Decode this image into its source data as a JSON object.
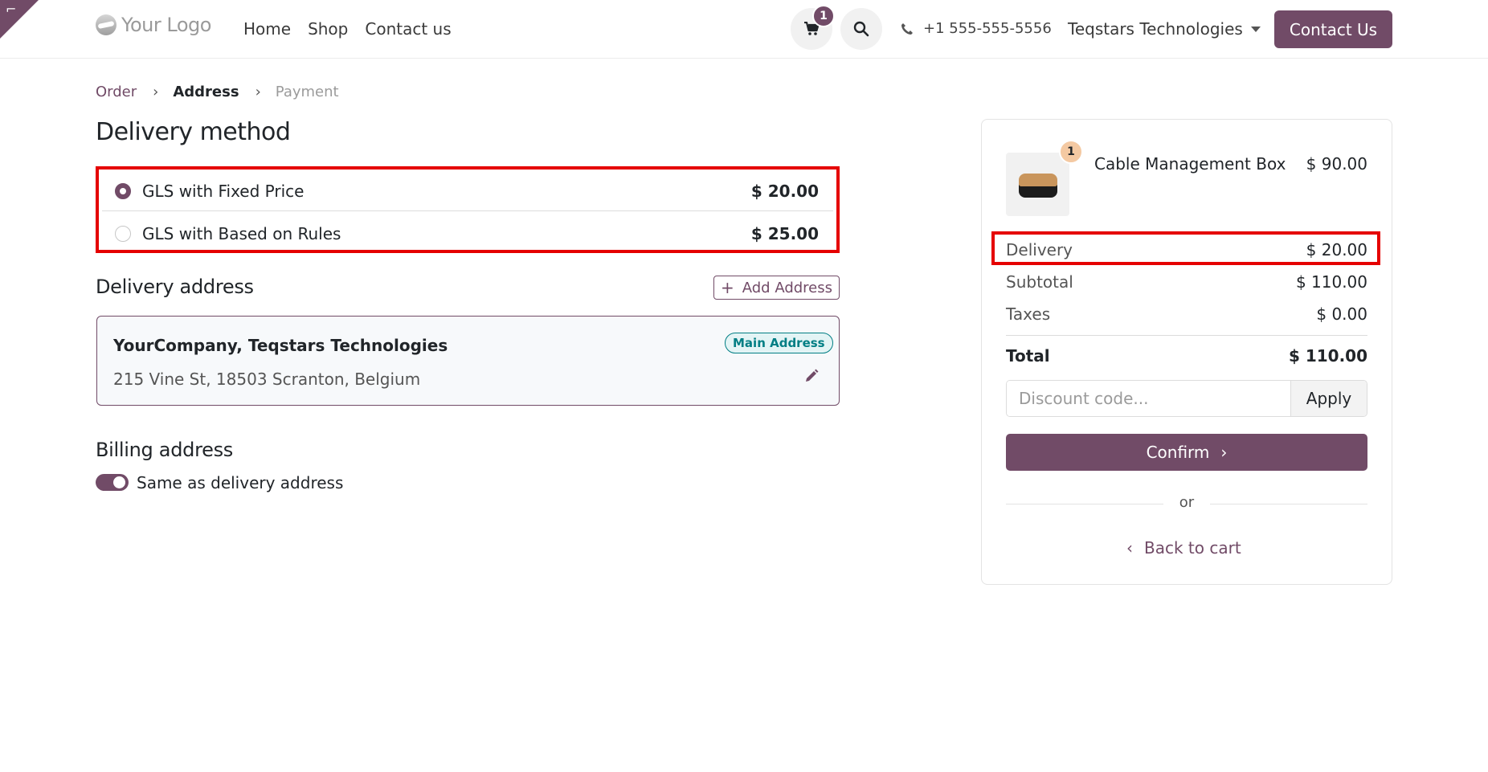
{
  "header": {
    "logo_text": "Your Logo",
    "nav": [
      "Home",
      "Shop",
      "Contact us"
    ],
    "cart_count": "1",
    "phone": "+1 555-555-5556",
    "company": "Teqstars Technologies",
    "contact_button": "Contact Us"
  },
  "breadcrumb": {
    "order": "Order",
    "address": "Address",
    "payment": "Payment"
  },
  "delivery_method": {
    "title": "Delivery method",
    "options": [
      {
        "label": "GLS with Fixed Price",
        "price": "$ 20.00",
        "selected": true
      },
      {
        "label": "GLS with Based on Rules",
        "price": "$ 25.00",
        "selected": false
      }
    ]
  },
  "delivery_address": {
    "title": "Delivery address",
    "add_button": "Add Address",
    "card": {
      "name": "YourCompany, Teqstars Technologies",
      "badge": "Main Address",
      "line": "215 Vine St, 18503 Scranton, Belgium"
    }
  },
  "billing_address": {
    "title": "Billing address",
    "toggle_label": "Same as delivery address",
    "toggle_on": true
  },
  "summary": {
    "product": {
      "name": "Cable Management Box",
      "price": "$ 90.00",
      "qty": "1"
    },
    "delivery_label": "Delivery",
    "delivery_value": "$ 20.00",
    "subtotal_label": "Subtotal",
    "subtotal_value": "$ 110.00",
    "taxes_label": "Taxes",
    "taxes_value": "$ 0.00",
    "total_label": "Total",
    "total_value": "$ 110.00",
    "discount_placeholder": "Discount code...",
    "apply_label": "Apply",
    "confirm_label": "Confirm",
    "or_text": "or",
    "back_label": "Back to cart"
  },
  "colors": {
    "brand": "#714b67",
    "highlight": "#e50000",
    "badge_teal": "#017e84"
  }
}
